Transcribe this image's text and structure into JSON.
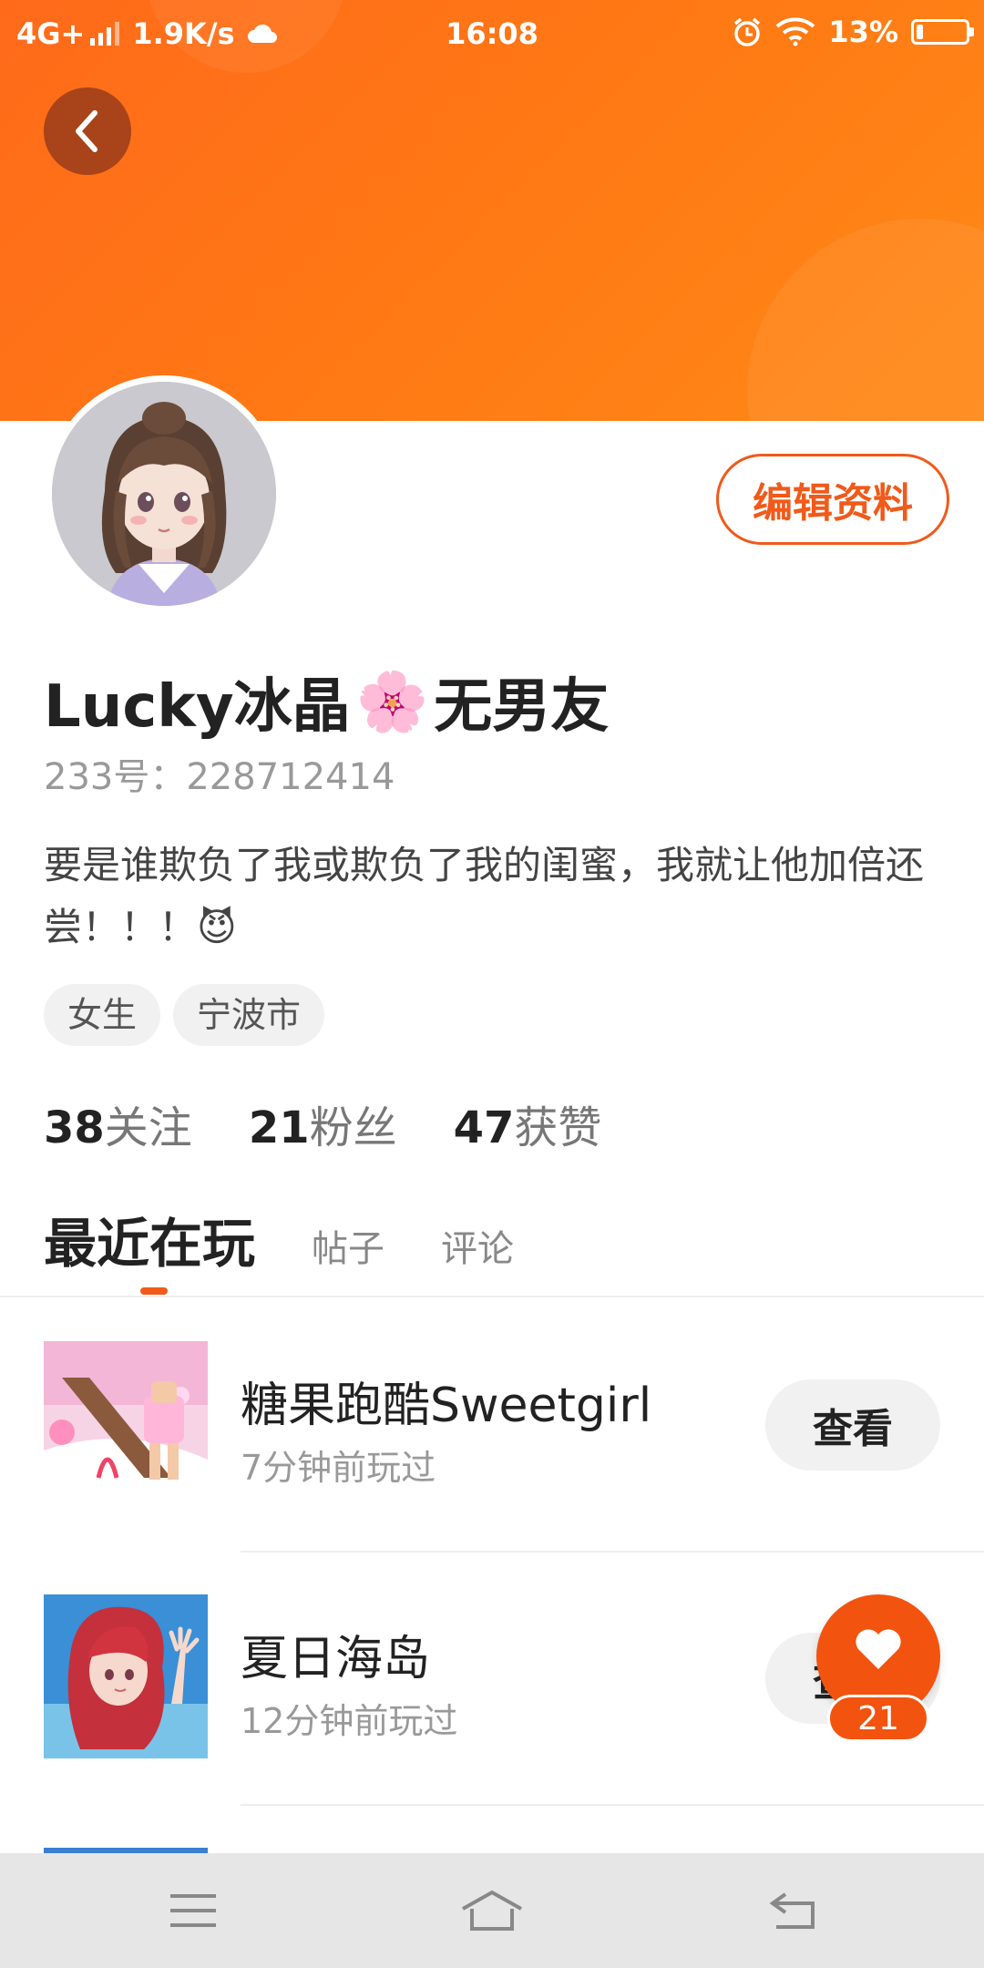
{
  "status_bar": {
    "network": "4G+",
    "speed": "1.9K/s",
    "time": "16:08",
    "battery": "13%",
    "battery_level": 0.13
  },
  "colors": {
    "accent": "#f05a1a",
    "header_gradient_start": "#ff6a1a",
    "header_gradient_end": "#ff8a18"
  },
  "header": {
    "back_icon": "chevron-left-icon",
    "edit_label": "编辑资料"
  },
  "profile": {
    "name_part1": "Lucky冰晶",
    "name_emoji": "🌸",
    "name_part2": "无男友",
    "uid": "233号：228712414",
    "bio": "要是谁欺负了我或欺负了我的闺蜜，我就让他加倍还尝！！！😈",
    "tags": [
      "女生",
      "宁波市"
    ]
  },
  "stats": [
    {
      "count": "38",
      "label": "关注"
    },
    {
      "count": "21",
      "label": "粉丝"
    },
    {
      "count": "47",
      "label": "获赞"
    }
  ],
  "tabs": {
    "active": "最近在玩",
    "items": [
      "帖子",
      "评论"
    ]
  },
  "recent_games": [
    {
      "title": "糖果跑酷Sweetgirl",
      "time": "7分钟前玩过",
      "button": "查看"
    },
    {
      "title": "夏日海岛",
      "time": "12分钟前玩过",
      "button": "查看"
    }
  ],
  "like_fab": {
    "icon": "heart-icon",
    "count": "21"
  },
  "nav_bar": {
    "icons": [
      "menu-icon",
      "home-icon",
      "back-icon"
    ]
  }
}
